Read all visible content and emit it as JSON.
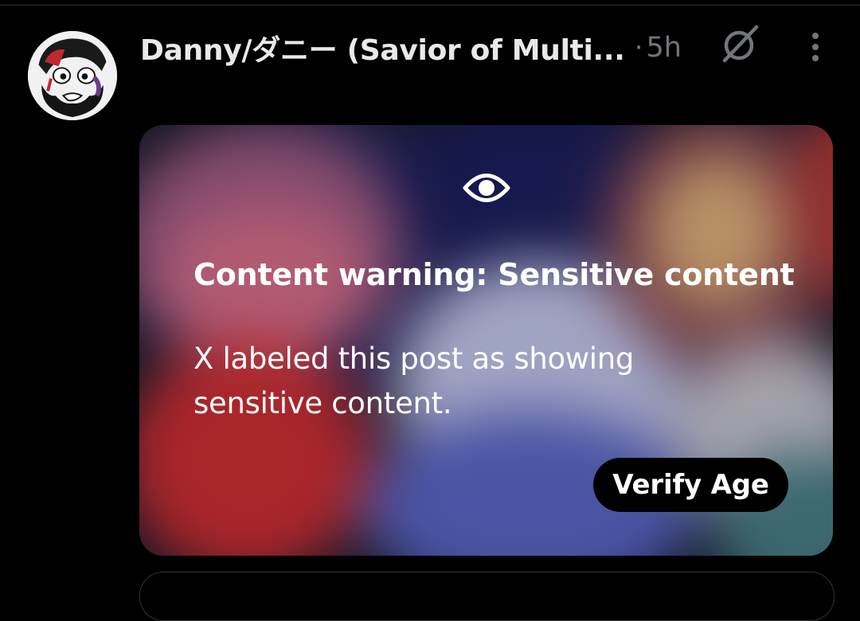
{
  "post": {
    "author_display_name": "Danny/ダニー (Savior of Multi...",
    "separator": "·",
    "timestamp": "5h",
    "avatar_icon": "cartoon-bearded-face-avatar",
    "grok_icon": "grok-slash-circle-icon",
    "more_icon": "vertical-dots-icon"
  },
  "media": {
    "warning_icon": "eye-icon",
    "warning_title": "Content warning: Sensitive content",
    "warning_body": "X labeled this post as showing sensitive content.",
    "verify_button_label": "Verify Age"
  },
  "colors": {
    "background": "#000000",
    "primary_text": "#e7e9ea",
    "secondary_text": "#71767b",
    "button_bg": "#000000",
    "button_text": "#ffffff",
    "divider": "#2f3336"
  }
}
